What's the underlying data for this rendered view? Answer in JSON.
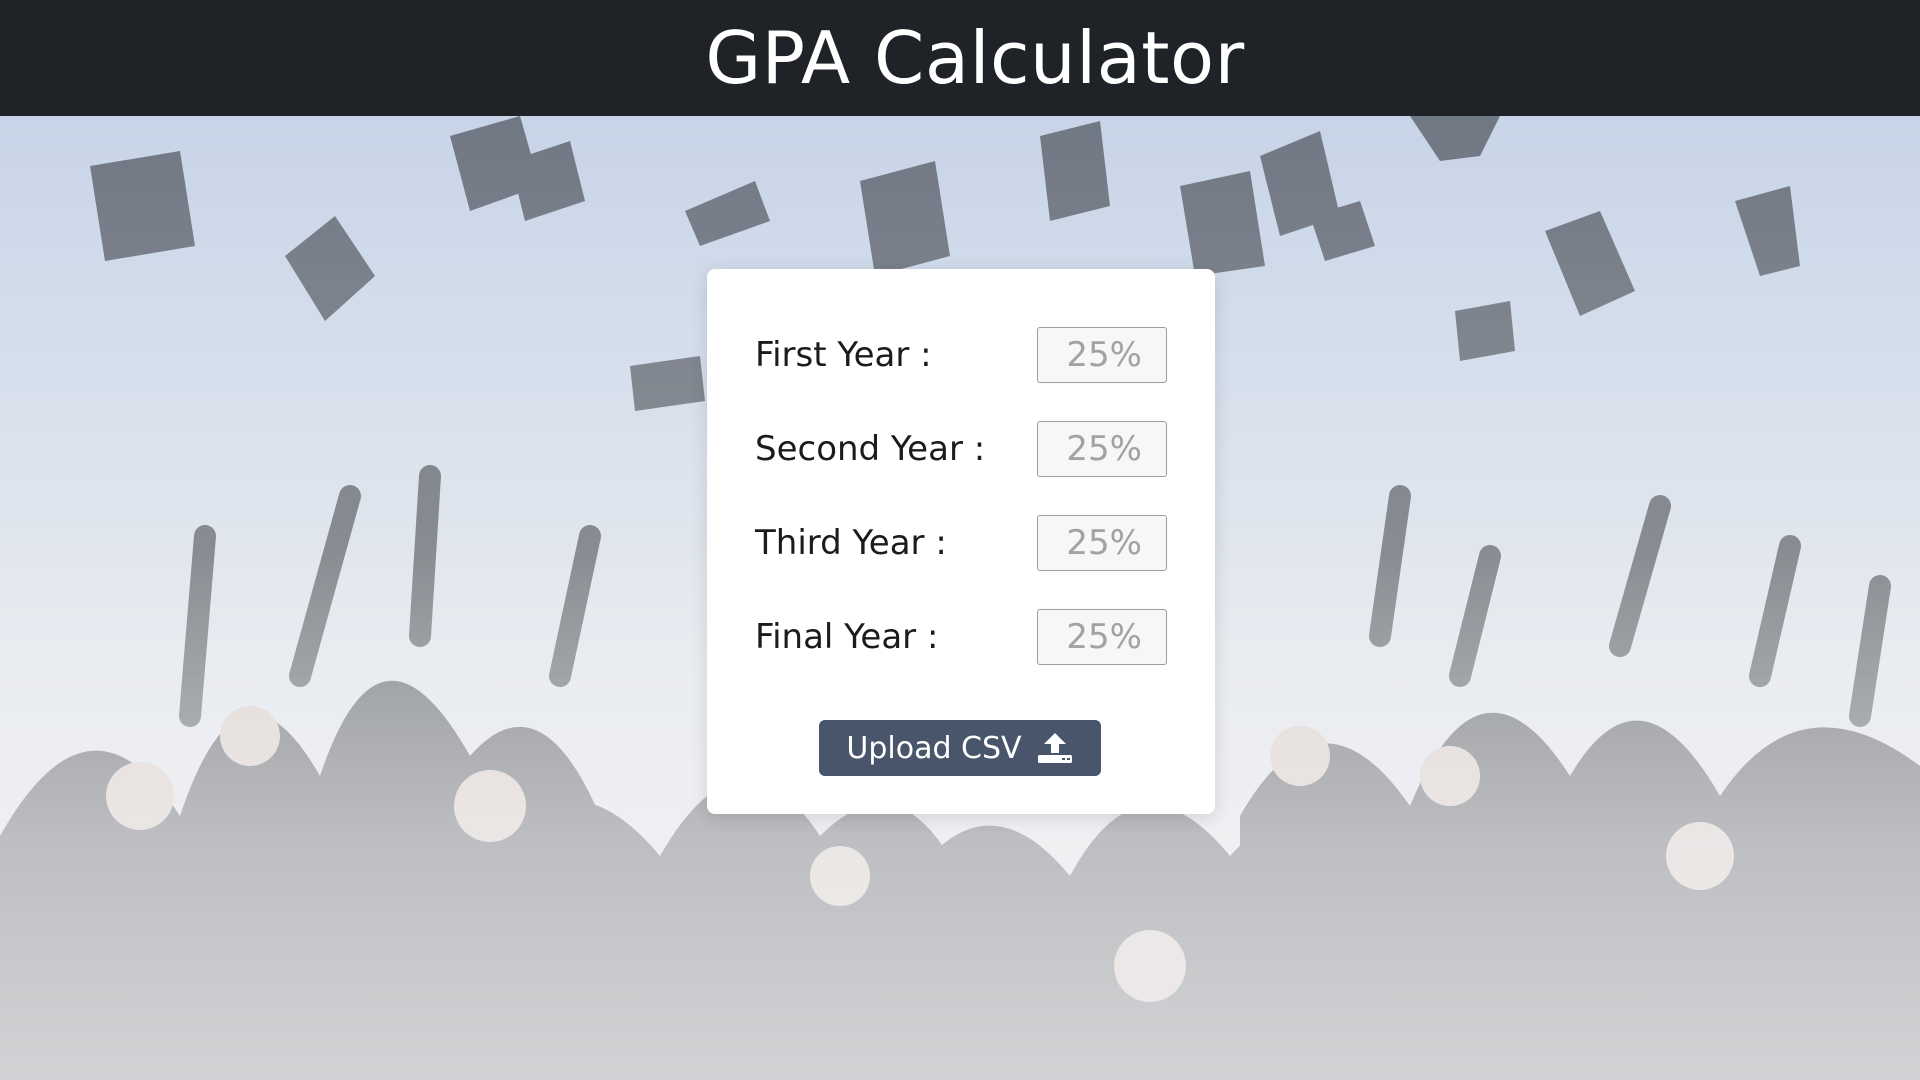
{
  "header": {
    "title": "GPA Calculator"
  },
  "form": {
    "rows": [
      {
        "label": "First Year :",
        "placeholder": "25%"
      },
      {
        "label": "Second Year :",
        "placeholder": "25%"
      },
      {
        "label": "Third Year :",
        "placeholder": "25%"
      },
      {
        "label": "Final Year :",
        "placeholder": "25%"
      }
    ],
    "upload_button": {
      "label": "Upload CSV",
      "icon": "upload-icon"
    }
  },
  "colors": {
    "header_bg": "#1f2227",
    "button_bg": "#48556b",
    "card_bg": "#ffffff"
  }
}
